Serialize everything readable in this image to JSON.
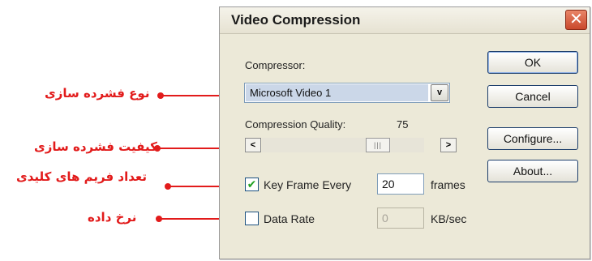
{
  "annotations": [
    "نوع فشرده سازی",
    "کیفیت فشرده سازی",
    "تعداد فریم های کلیدی",
    "نرخ داده"
  ],
  "dialog": {
    "title": "Video Compression",
    "close_icon": "close-icon",
    "compressor_label": "Compressor:",
    "compressor_value": "Microsoft Video 1",
    "quality_label": "Compression Quality:",
    "quality_value": "75",
    "quality_level": 0.75,
    "scroll_left_glyph": "<",
    "scroll_right_glyph": ">",
    "dropdown_glyph": "v",
    "thumb_glyph": "|||",
    "key_frame_checked": true,
    "key_frame_label": "Key Frame Every",
    "key_frame_value": "20",
    "key_frame_unit": "frames",
    "data_rate_checked": false,
    "data_rate_label": "Data Rate",
    "data_rate_value": "0",
    "data_rate_unit": "KB/sec",
    "buttons": {
      "ok": "OK",
      "cancel": "Cancel",
      "configure": "Configure...",
      "about": "About..."
    }
  },
  "colors": {
    "annotation": "#e21b1b",
    "dialog_bg": "#ece9d8",
    "close_button": "#c9482c"
  }
}
